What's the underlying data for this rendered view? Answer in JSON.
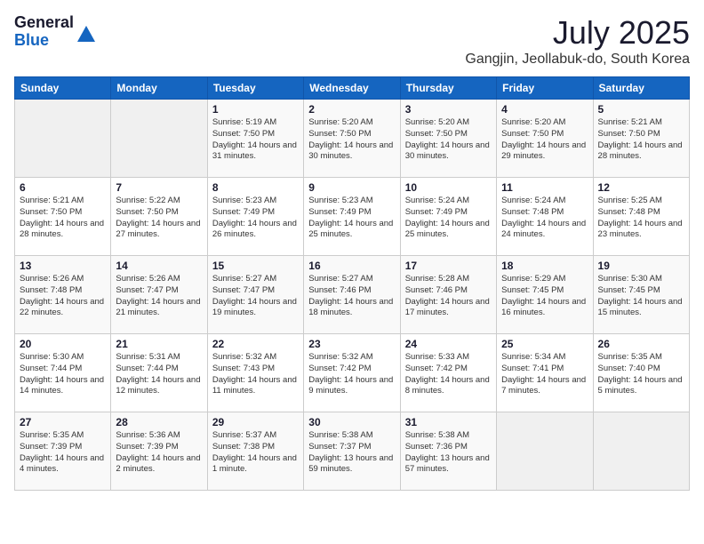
{
  "header": {
    "logo_general": "General",
    "logo_blue": "Blue",
    "month_title": "July 2025",
    "subtitle": "Gangjin, Jeollabuk-do, South Korea"
  },
  "days_of_week": [
    "Sunday",
    "Monday",
    "Tuesday",
    "Wednesday",
    "Thursday",
    "Friday",
    "Saturday"
  ],
  "weeks": [
    [
      {
        "day": "",
        "info": ""
      },
      {
        "day": "",
        "info": ""
      },
      {
        "day": "1",
        "info": "Sunrise: 5:19 AM\nSunset: 7:50 PM\nDaylight: 14 hours and 31 minutes."
      },
      {
        "day": "2",
        "info": "Sunrise: 5:20 AM\nSunset: 7:50 PM\nDaylight: 14 hours and 30 minutes."
      },
      {
        "day": "3",
        "info": "Sunrise: 5:20 AM\nSunset: 7:50 PM\nDaylight: 14 hours and 30 minutes."
      },
      {
        "day": "4",
        "info": "Sunrise: 5:20 AM\nSunset: 7:50 PM\nDaylight: 14 hours and 29 minutes."
      },
      {
        "day": "5",
        "info": "Sunrise: 5:21 AM\nSunset: 7:50 PM\nDaylight: 14 hours and 28 minutes."
      }
    ],
    [
      {
        "day": "6",
        "info": "Sunrise: 5:21 AM\nSunset: 7:50 PM\nDaylight: 14 hours and 28 minutes."
      },
      {
        "day": "7",
        "info": "Sunrise: 5:22 AM\nSunset: 7:50 PM\nDaylight: 14 hours and 27 minutes."
      },
      {
        "day": "8",
        "info": "Sunrise: 5:23 AM\nSunset: 7:49 PM\nDaylight: 14 hours and 26 minutes."
      },
      {
        "day": "9",
        "info": "Sunrise: 5:23 AM\nSunset: 7:49 PM\nDaylight: 14 hours and 25 minutes."
      },
      {
        "day": "10",
        "info": "Sunrise: 5:24 AM\nSunset: 7:49 PM\nDaylight: 14 hours and 25 minutes."
      },
      {
        "day": "11",
        "info": "Sunrise: 5:24 AM\nSunset: 7:48 PM\nDaylight: 14 hours and 24 minutes."
      },
      {
        "day": "12",
        "info": "Sunrise: 5:25 AM\nSunset: 7:48 PM\nDaylight: 14 hours and 23 minutes."
      }
    ],
    [
      {
        "day": "13",
        "info": "Sunrise: 5:26 AM\nSunset: 7:48 PM\nDaylight: 14 hours and 22 minutes."
      },
      {
        "day": "14",
        "info": "Sunrise: 5:26 AM\nSunset: 7:47 PM\nDaylight: 14 hours and 21 minutes."
      },
      {
        "day": "15",
        "info": "Sunrise: 5:27 AM\nSunset: 7:47 PM\nDaylight: 14 hours and 19 minutes."
      },
      {
        "day": "16",
        "info": "Sunrise: 5:27 AM\nSunset: 7:46 PM\nDaylight: 14 hours and 18 minutes."
      },
      {
        "day": "17",
        "info": "Sunrise: 5:28 AM\nSunset: 7:46 PM\nDaylight: 14 hours and 17 minutes."
      },
      {
        "day": "18",
        "info": "Sunrise: 5:29 AM\nSunset: 7:45 PM\nDaylight: 14 hours and 16 minutes."
      },
      {
        "day": "19",
        "info": "Sunrise: 5:30 AM\nSunset: 7:45 PM\nDaylight: 14 hours and 15 minutes."
      }
    ],
    [
      {
        "day": "20",
        "info": "Sunrise: 5:30 AM\nSunset: 7:44 PM\nDaylight: 14 hours and 14 minutes."
      },
      {
        "day": "21",
        "info": "Sunrise: 5:31 AM\nSunset: 7:44 PM\nDaylight: 14 hours and 12 minutes."
      },
      {
        "day": "22",
        "info": "Sunrise: 5:32 AM\nSunset: 7:43 PM\nDaylight: 14 hours and 11 minutes."
      },
      {
        "day": "23",
        "info": "Sunrise: 5:32 AM\nSunset: 7:42 PM\nDaylight: 14 hours and 9 minutes."
      },
      {
        "day": "24",
        "info": "Sunrise: 5:33 AM\nSunset: 7:42 PM\nDaylight: 14 hours and 8 minutes."
      },
      {
        "day": "25",
        "info": "Sunrise: 5:34 AM\nSunset: 7:41 PM\nDaylight: 14 hours and 7 minutes."
      },
      {
        "day": "26",
        "info": "Sunrise: 5:35 AM\nSunset: 7:40 PM\nDaylight: 14 hours and 5 minutes."
      }
    ],
    [
      {
        "day": "27",
        "info": "Sunrise: 5:35 AM\nSunset: 7:39 PM\nDaylight: 14 hours and 4 minutes."
      },
      {
        "day": "28",
        "info": "Sunrise: 5:36 AM\nSunset: 7:39 PM\nDaylight: 14 hours and 2 minutes."
      },
      {
        "day": "29",
        "info": "Sunrise: 5:37 AM\nSunset: 7:38 PM\nDaylight: 14 hours and 1 minute."
      },
      {
        "day": "30",
        "info": "Sunrise: 5:38 AM\nSunset: 7:37 PM\nDaylight: 13 hours and 59 minutes."
      },
      {
        "day": "31",
        "info": "Sunrise: 5:38 AM\nSunset: 7:36 PM\nDaylight: 13 hours and 57 minutes."
      },
      {
        "day": "",
        "info": ""
      },
      {
        "day": "",
        "info": ""
      }
    ]
  ]
}
